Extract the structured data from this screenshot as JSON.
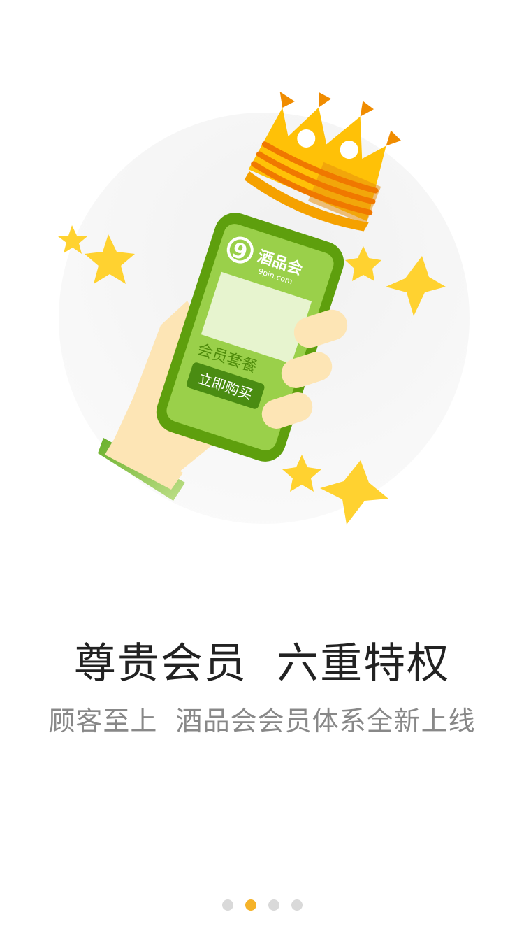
{
  "phone_screen": {
    "logo_mark": "9",
    "logo_text": "酒品会",
    "logo_domain": "9pin.com",
    "package_label": "会员套餐",
    "buy_button_label": "立即购买"
  },
  "headline": "尊贵会员  六重特权",
  "subline": "顾客至上  酒品会会员体系全新上线",
  "pager": {
    "total": 4,
    "active_index": 1
  },
  "colors": {
    "accent_green": "#6aad1f",
    "pager_active": "#f5b32a",
    "pager_inactive": "#d9d9d9",
    "star_yellow": "#ffd230",
    "crown_orange": "#f5a100"
  }
}
